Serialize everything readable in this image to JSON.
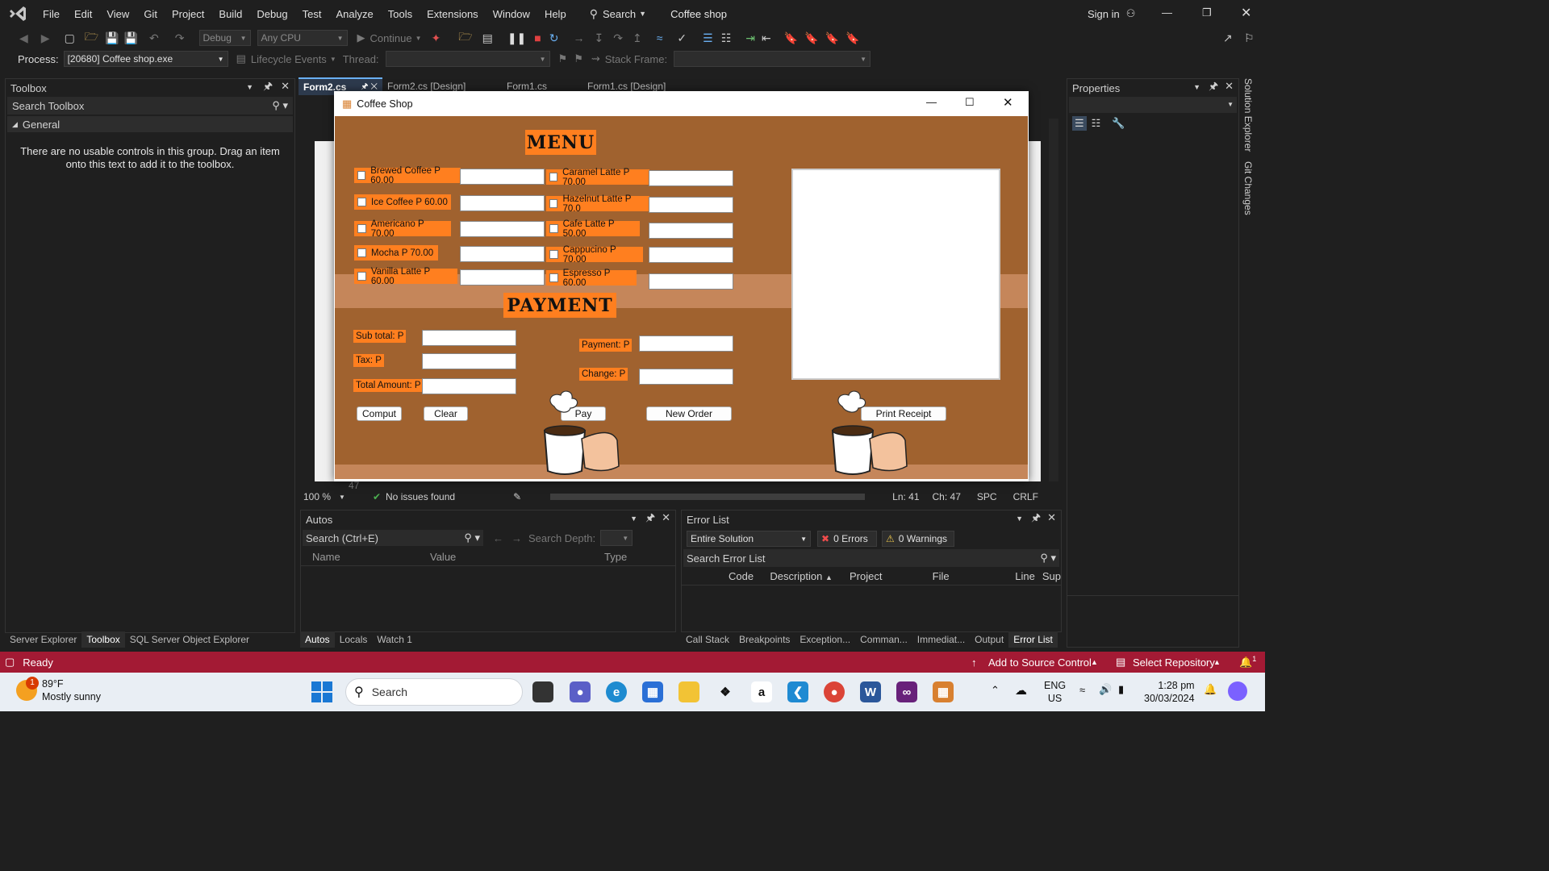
{
  "menubar": {
    "items": [
      "File",
      "Edit",
      "View",
      "Git",
      "Project",
      "Build",
      "Debug",
      "Test",
      "Analyze",
      "Tools",
      "Extensions",
      "Window",
      "Help"
    ],
    "search_label": "Search",
    "solution_title": "Coffee shop",
    "sign_in": "Sign in"
  },
  "toolbar": {
    "config": "Debug",
    "platform": "Any CPU",
    "continue_label": "Continue",
    "process_label": "Process:",
    "process_value": "[20680] Coffee shop.exe",
    "lifecycle_label": "Lifecycle Events",
    "thread_label": "Thread:",
    "stack_frame_label": "Stack Frame:"
  },
  "toolbox": {
    "title": "Toolbox",
    "search_placeholder": "Search Toolbox",
    "group": "General",
    "empty_message": "There are no usable controls in this group. Drag an item onto this text to add it to the toolbox."
  },
  "doc_tabs": [
    "Form2.cs",
    "Form2.cs [Design]",
    "Form1.cs",
    "Form1.cs [Design]"
  ],
  "editor_status": {
    "zoom": "100 %",
    "issues": "No issues found",
    "ln": "Ln: 41",
    "ch": "Ch: 47",
    "spc": "SPC",
    "crlf": "CRLF",
    "margin_number": "47"
  },
  "properties": {
    "title": "Properties"
  },
  "right_rail": [
    "Solution Explorer",
    "Git Changes"
  ],
  "coffee_form": {
    "title": "Coffee Shop",
    "menu_heading": "MENU",
    "payment_heading": "PAYMENT",
    "left_items": [
      "Brewed Coffee P 60.00",
      "Ice Coffee P 60.00",
      "Americano P 70.00",
      "Mocha P 70.00",
      "Vanilla Latte P 60.00"
    ],
    "right_items": [
      "Caramel Latte P 70.00",
      "Hazelnut Latte P 70.0",
      "Cafe Latte P 50.00",
      "Cappucino P 70.00",
      "Espresso P 60.00"
    ],
    "subtotal_label": "Sub total: P",
    "tax_label": "Tax: P",
    "total_label": "Total Amount: P",
    "payment_label": "Payment: P",
    "change_label": "Change: P",
    "compute_btn": "Comput",
    "clear_btn": "Clear",
    "pay_btn": "Pay",
    "new_order_btn": "New Order",
    "print_btn": "Print Receipt",
    "colors": {
      "bg": "#a0622f",
      "accent": "#ff7f1f",
      "band": "#c5865a"
    }
  },
  "autos": {
    "title": "Autos",
    "search_placeholder": "Search (Ctrl+E)",
    "search_depth": "Search Depth:",
    "columns": [
      "Name",
      "Value",
      "Type"
    ],
    "tabs": [
      "Autos",
      "Locals",
      "Watch 1"
    ]
  },
  "error_list": {
    "title": "Error List",
    "scope": "Entire Solution",
    "errors": "0 Errors",
    "warnings": "0 Warnings",
    "search_placeholder": "Search Error List",
    "columns": [
      "Code",
      "Description",
      "Project",
      "File",
      "Line",
      "Sup"
    ],
    "tabs": [
      "Call Stack",
      "Breakpoints",
      "Exception...",
      "Comman...",
      "Immediat...",
      "Output",
      "Error List"
    ]
  },
  "bottom_left_tabs": [
    "Server Explorer",
    "Toolbox",
    "SQL Server Object Explorer"
  ],
  "statusbar": {
    "ready": "Ready",
    "source_control": "Add to Source Control",
    "repository": "Select Repository",
    "notif_count": "1"
  },
  "taskbar": {
    "weather_temp": "89°F",
    "weather_desc": "Mostly sunny",
    "weather_badge": "1",
    "search_placeholder": "Search",
    "lang_top": "ENG",
    "lang_bottom": "US",
    "time": "1:28 pm",
    "date": "30/03/2024"
  }
}
